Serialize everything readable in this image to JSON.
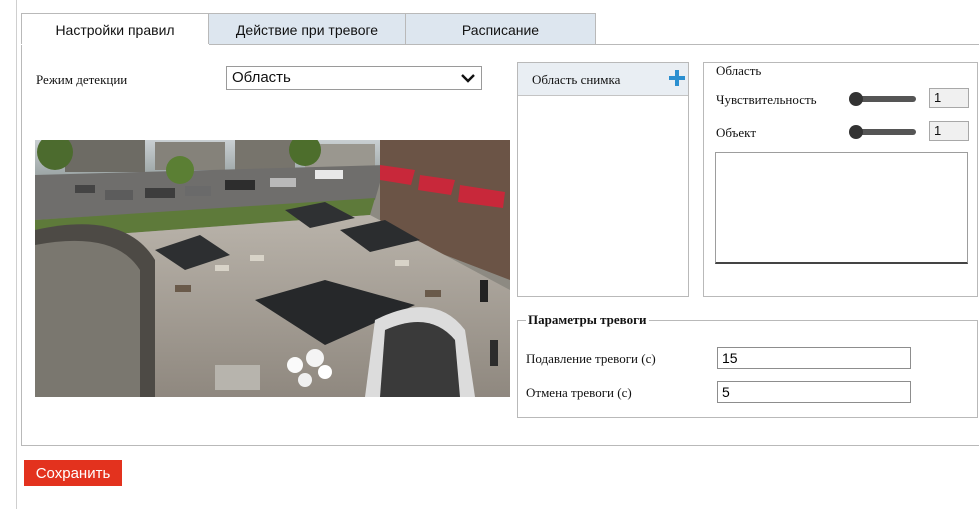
{
  "tabs": [
    {
      "label": "Настройки правил",
      "active": true
    },
    {
      "label": "Действие при тревоге",
      "active": false
    },
    {
      "label": "Расписание",
      "active": false
    }
  ],
  "detection": {
    "label": "Режим детекции",
    "selected": "Область"
  },
  "area_list": {
    "header": "Область снимка",
    "add_icon": "plus-icon"
  },
  "area_settings": {
    "title": "Область",
    "sensitivity_label": "Чувствительность",
    "sensitivity_value": "1",
    "object_label": "Объект",
    "object_value": "1"
  },
  "alarm_params": {
    "title": "Параметры тревоги",
    "suppression_label": "Подавление тревоги (с)",
    "suppression_value": "15",
    "cancel_label": "Отмена тревоги (с)",
    "cancel_value": "5"
  },
  "save_label": "Сохранить",
  "colors": {
    "accent": "#e3321e",
    "tab_inactive": "#dde6ef",
    "plus": "#2a8fd0"
  }
}
